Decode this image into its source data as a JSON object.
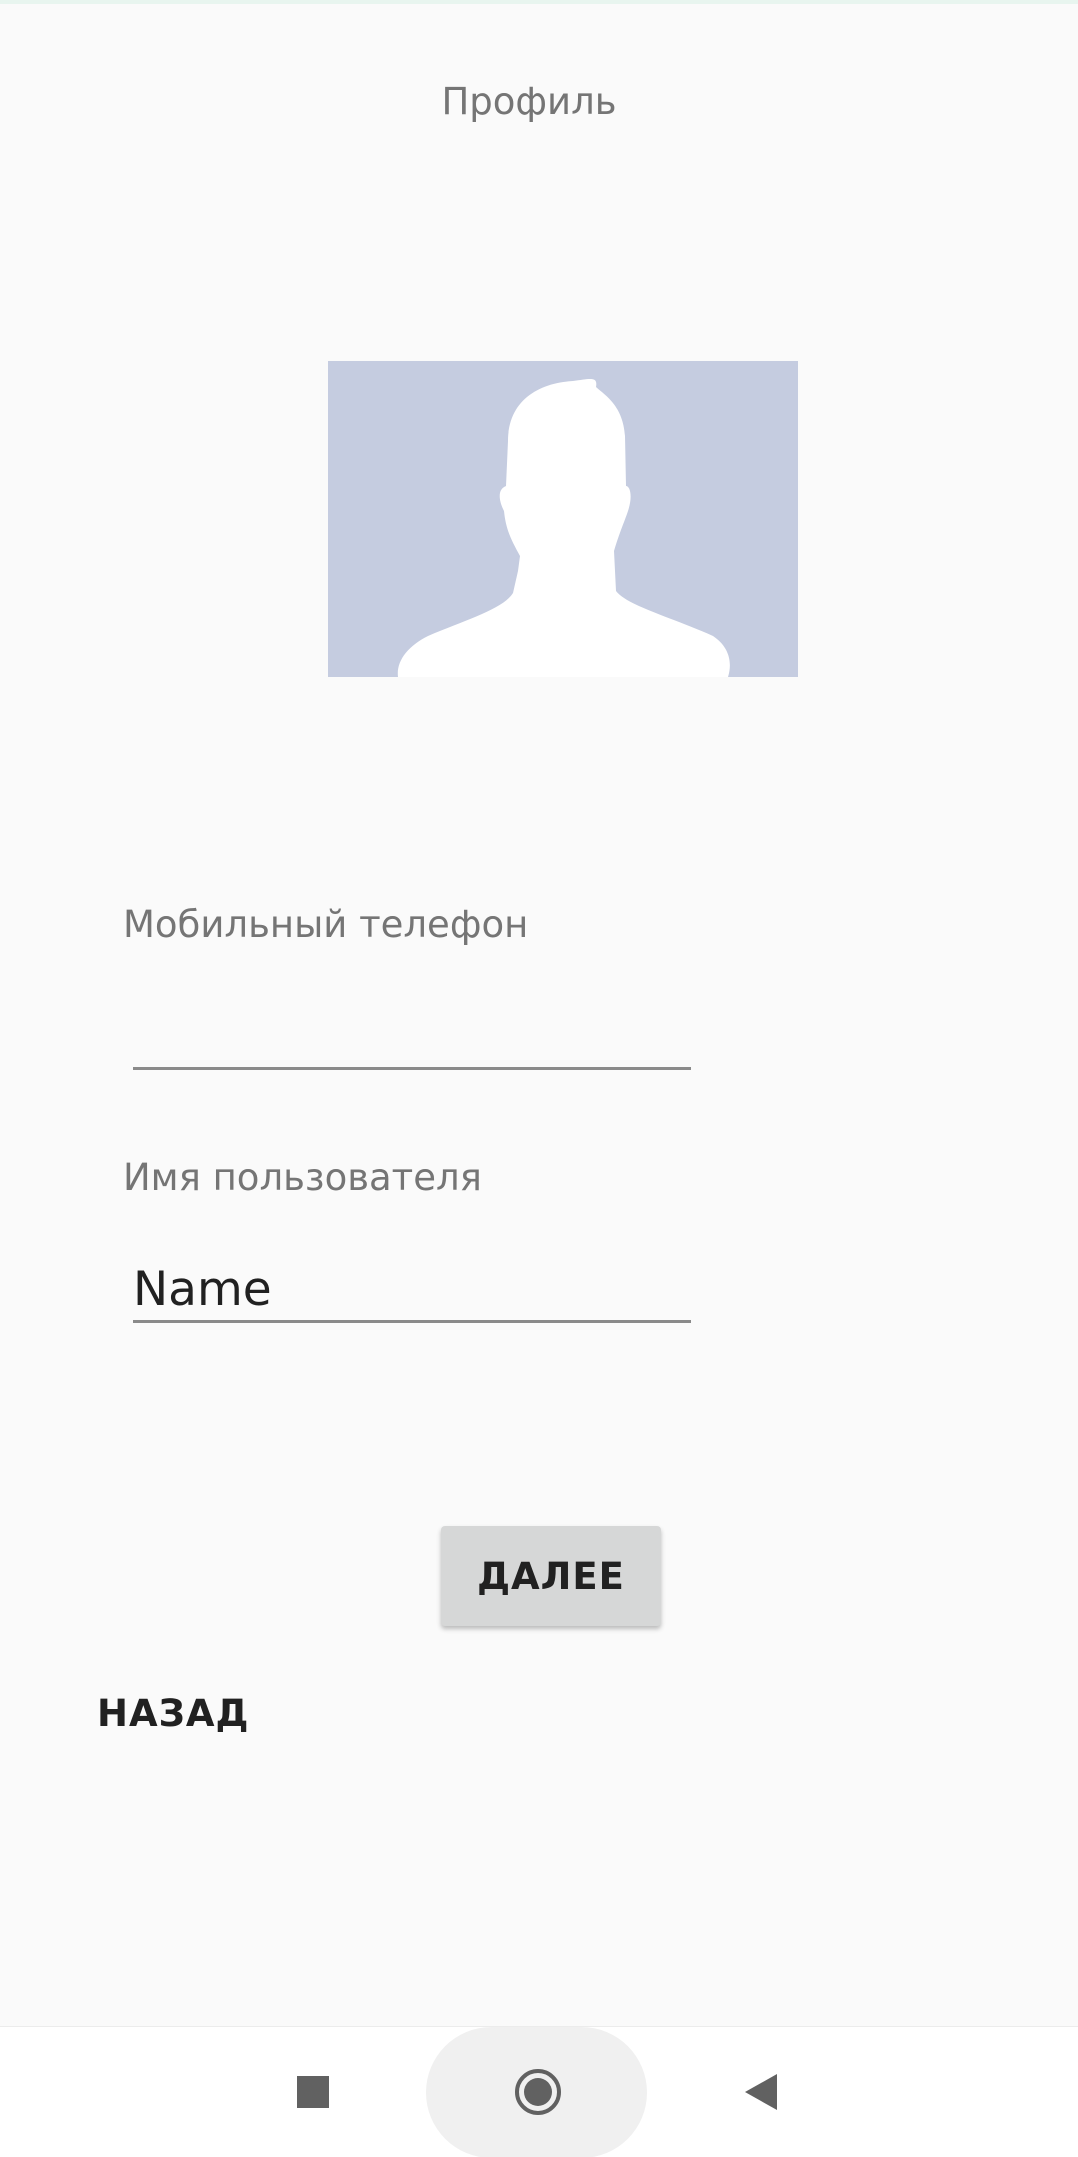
{
  "header": {
    "title": "Профиль"
  },
  "avatar": {
    "icon": "default-profile-silhouette",
    "background_color": "#c5cce0"
  },
  "form": {
    "phone": {
      "label": "Мобильный телефон",
      "value": ""
    },
    "username": {
      "label": "Имя пользователя",
      "value": "Name"
    }
  },
  "actions": {
    "next_label": "ДАЛЕЕ",
    "back_label": "НАЗАД"
  },
  "navbar": {
    "recents_icon": "square-icon",
    "home_icon": "circle-icon",
    "back_icon": "triangle-back-icon"
  }
}
